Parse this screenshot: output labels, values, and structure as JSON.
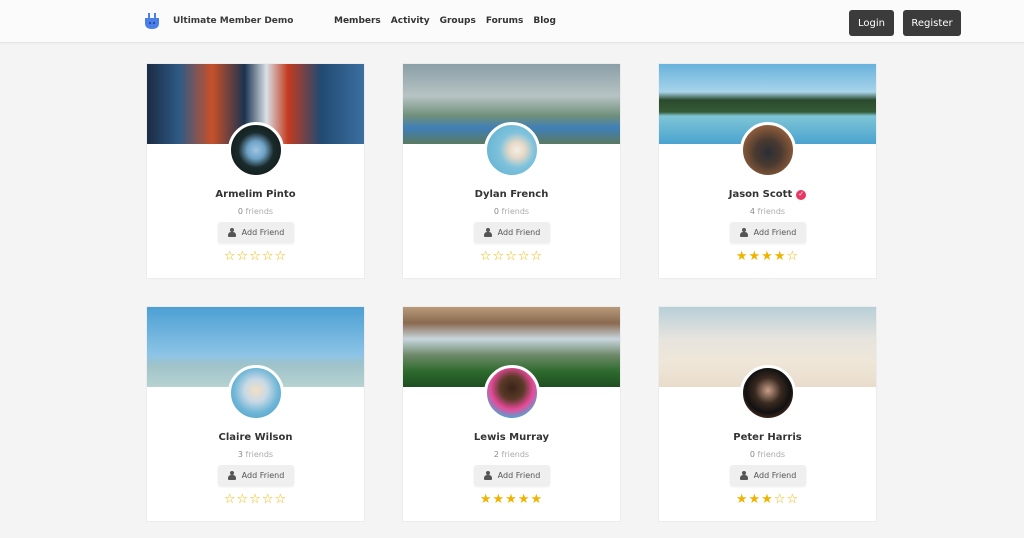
{
  "header": {
    "site_title": "Ultimate Member Demo",
    "logo_icon": "plug-logo-icon",
    "nav": [
      "Members",
      "Activity",
      "Groups",
      "Forums",
      "Blog"
    ],
    "login_label": "Login",
    "register_label": "Register"
  },
  "members": [
    {
      "name": "Armelim Pinto",
      "friends_count": "0",
      "friends_label": "friends",
      "button": "Add Friend",
      "rating": 0,
      "verified": false,
      "cover": "night-city-street",
      "avatar": "man-in-tunnel"
    },
    {
      "name": "Dylan French",
      "friends_count": "0",
      "friends_label": "friends",
      "button": "Add Friend",
      "rating": 0,
      "verified": false,
      "cover": "mountain-lake",
      "avatar": "man-blue-sky"
    },
    {
      "name": "Jason Scott",
      "friends_count": "4",
      "friends_label": "friends",
      "button": "Add Friend",
      "rating": 4,
      "verified": true,
      "cover": "tropical-island",
      "avatar": "smiling-man"
    },
    {
      "name": "Claire Wilson",
      "friends_count": "3",
      "friends_label": "friends",
      "button": "Add Friend",
      "rating": 0,
      "verified": false,
      "cover": "pineapple-sky",
      "avatar": "blonde-woman"
    },
    {
      "name": "Lewis Murray",
      "friends_count": "2",
      "friends_label": "friends",
      "button": "Add Friend",
      "rating": 5,
      "verified": false,
      "cover": "misty-valley",
      "avatar": "man-colorful-wall"
    },
    {
      "name": "Peter Harris",
      "friends_count": "0",
      "friends_label": "friends",
      "button": "Add Friend",
      "rating": 3,
      "verified": false,
      "cover": "pineapple-beach",
      "avatar": "man-sunglasses"
    }
  ],
  "colors": {
    "star": "#f0b400",
    "verified": "#e8385f",
    "button_dark": "#3b3b3b"
  }
}
